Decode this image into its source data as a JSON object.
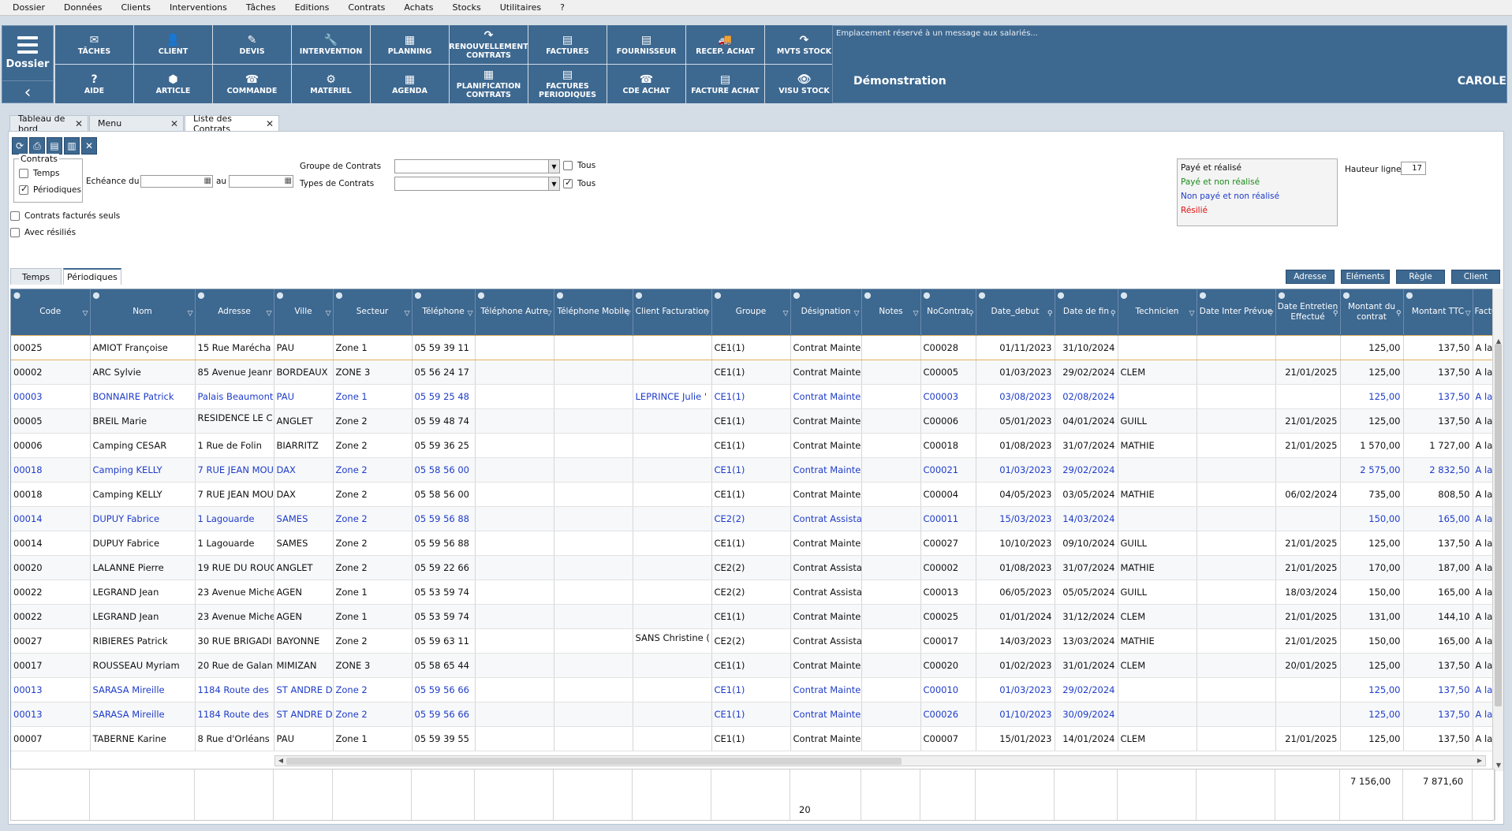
{
  "menu": [
    "Dossier",
    "Données",
    "Clients",
    "Interventions",
    "Tâches",
    "Editions",
    "Contrats",
    "Achats",
    "Stocks",
    "Utilitaires",
    "?"
  ],
  "dossier": {
    "label": "Dossier",
    "icon": "hamburger-icon",
    "back_icon": "chevron-left-icon"
  },
  "toolbar_buttons": [
    {
      "label": "TÂCHES",
      "icon": "✉"
    },
    {
      "label": "CLIENT",
      "icon": "👤"
    },
    {
      "label": "DEVIS",
      "icon": "✎"
    },
    {
      "label": "INTERVENTION",
      "icon": "🔧"
    },
    {
      "label": "PLANNING",
      "icon": "▦"
    },
    {
      "label": "RENOUVELLEMENT CONTRATS",
      "icon": "↷"
    },
    {
      "label": "FACTURES",
      "icon": "▤"
    },
    {
      "label": "FOURNISSEUR",
      "icon": "▤"
    },
    {
      "label": "RECEP. ACHAT",
      "icon": "🚚"
    },
    {
      "label": "MVTS STOCK",
      "icon": "↷"
    },
    {
      "label": "AIDE",
      "icon": "?"
    },
    {
      "label": "ARTICLE",
      "icon": "⬢"
    },
    {
      "label": "COMMANDE",
      "icon": "☎"
    },
    {
      "label": "MATERIEL",
      "icon": "⚙"
    },
    {
      "label": "AGENDA",
      "icon": "▦"
    },
    {
      "label": "PLANIFICATION CONTRATS",
      "icon": "▦"
    },
    {
      "label": "FACTURES PERIODIQUES",
      "icon": "▤"
    },
    {
      "label": "CDE ACHAT",
      "icon": "☎"
    },
    {
      "label": "FACTURE ACHAT",
      "icon": "▤"
    },
    {
      "label": "VISU STOCK",
      "icon": "👁"
    }
  ],
  "message_panel": {
    "text": "Emplacement réservé à un  message aux salariés...",
    "company": "Démonstration",
    "user": "CAROLE"
  },
  "tabs": [
    {
      "label": "Tableau de bord",
      "active": false
    },
    {
      "label": "Menu",
      "active": false
    },
    {
      "label": "Liste des Contrats",
      "active": true
    }
  ],
  "filters": {
    "contrats_legend": "Contrats",
    "temps": {
      "label": "Temps",
      "checked": false
    },
    "periodiques": {
      "label": "Périodiques",
      "checked": true
    },
    "echeance_label": "Echéance du",
    "au_label": "au",
    "factures_seuls": {
      "label": "Contrats facturés seuls",
      "checked": false
    },
    "avec_resilies": {
      "label": "Avec résiliés",
      "checked": false
    },
    "groupe_label": "Groupe de Contrats",
    "types_label": "Types de Contrats",
    "tous1": {
      "label": "Tous",
      "checked": false
    },
    "tous2": {
      "label": "Tous",
      "checked": true
    }
  },
  "legend": [
    {
      "label": "Payé et réalisé",
      "color": "#111111"
    },
    {
      "label": "Payé et non réalisé",
      "color": "#1a8a1a"
    },
    {
      "label": "Non payé et non réalisé",
      "color": "#1e3cc8"
    },
    {
      "label": "Résilié",
      "color": "#e01010"
    }
  ],
  "hauteur_ligne": {
    "label": "Hauteur ligne",
    "value": "17"
  },
  "subtabs": [
    {
      "label": "Temps",
      "active": false
    },
    {
      "label": "Périodiques",
      "active": true
    }
  ],
  "right_buttons": [
    "Adresse",
    "Eléments",
    "Règle",
    "Client"
  ],
  "columns": [
    {
      "label": "Code",
      "w": 100
    },
    {
      "label": "Nom",
      "w": 133
    },
    {
      "label": "Adresse",
      "w": 100
    },
    {
      "label": "Ville",
      "w": 75
    },
    {
      "label": "Secteur",
      "w": 100
    },
    {
      "label": "Téléphone",
      "w": 80
    },
    {
      "label": "Téléphone Autre",
      "w": 100
    },
    {
      "label": "Téléphone Mobile",
      "w": 100
    },
    {
      "label": "Client Facturation",
      "w": 100
    },
    {
      "label": "Groupe",
      "w": 100
    },
    {
      "label": "Désignation",
      "w": 90
    },
    {
      "label": "Notes",
      "w": 75
    },
    {
      "label": "NoContrat",
      "w": 70
    },
    {
      "label": "Date_debut",
      "w": 100
    },
    {
      "label": "Date de fin",
      "w": 80
    },
    {
      "label": "Technicien",
      "w": 100
    },
    {
      "label": "Date Inter Prévue",
      "w": 100
    },
    {
      "label": "Date Entretien Effectué",
      "w": 82
    },
    {
      "label": "Montant du contrat",
      "w": 80
    },
    {
      "label": "Montant TTC",
      "w": 88
    },
    {
      "label": "Factu",
      "w": 29
    }
  ],
  "rows": [
    {
      "blue": false,
      "cells": [
        "00025",
        "AMIOT Françoise",
        "15 Rue Marécha",
        "PAU",
        "Zone 1",
        "05 59 39 11",
        "",
        "",
        "",
        "CE1(1)",
        "Contrat Mainte",
        "",
        "C00028",
        "01/11/2023",
        "31/10/2024",
        "",
        "",
        "",
        "125,00",
        "137,50",
        "A la s"
      ]
    },
    {
      "blue": false,
      "cells": [
        "00002",
        "ARC Sylvie",
        "85 Avenue Jeanr",
        "BORDEAUX",
        "ZONE 3",
        "05 56 24 17",
        "",
        "",
        "",
        "CE1(1)",
        "Contrat Mainte",
        "",
        "C00005",
        "01/03/2023",
        "29/02/2024",
        "CLEM",
        "",
        "21/01/2025",
        "125,00",
        "137,50",
        "A la s"
      ]
    },
    {
      "blue": true,
      "cells": [
        "00003",
        "BONNAIRE Patrick",
        "Palais Beaumont",
        "PAU",
        "Zone 1",
        "05 59 25 48",
        "",
        "",
        "LEPRINCE Julie '",
        "CE1(1)",
        "Contrat Mainte",
        "",
        "C00003",
        "03/08/2023",
        "02/08/2024",
        "",
        "",
        "",
        "125,00",
        "137,50",
        "A la s"
      ]
    },
    {
      "blue": false,
      "top_addr": true,
      "cells": [
        "00005",
        "BREIL Marie",
        "RESIDENCE LE C",
        "ANGLET",
        "Zone 2",
        "05 59 48 74",
        "",
        "",
        "",
        "CE1(1)",
        "Contrat Mainte",
        "",
        "C00006",
        "05/01/2023",
        "04/01/2024",
        "GUILL",
        "",
        "21/01/2025",
        "125,00",
        "137,50",
        "A la s"
      ]
    },
    {
      "blue": false,
      "cells": [
        "00006",
        "Camping CESAR",
        "1 Rue de Folin",
        "BIARRITZ",
        "Zone 2",
        "05 59 36 25",
        "",
        "",
        "",
        "CE1(1)",
        "Contrat Mainte",
        "",
        "C00018",
        "01/08/2023",
        "31/07/2024",
        "MATHIE",
        "",
        "21/01/2025",
        "1 570,00",
        "1 727,00",
        "A la s"
      ]
    },
    {
      "blue": true,
      "cells": [
        "00018",
        "Camping KELLY",
        "7 RUE JEAN MOU",
        "DAX",
        "Zone 2",
        "05 58 56 00",
        "",
        "",
        "",
        "CE1(1)",
        "Contrat Mainte",
        "",
        "C00021",
        "01/03/2023",
        "29/02/2024",
        "",
        "",
        "",
        "2 575,00",
        "2 832,50",
        "A la s"
      ]
    },
    {
      "blue": false,
      "cells": [
        "00018",
        "Camping KELLY",
        "7 RUE JEAN MOU",
        "DAX",
        "Zone 2",
        "05 58 56 00",
        "",
        "",
        "",
        "CE1(1)",
        "Contrat Mainte",
        "",
        "C00004",
        "04/05/2023",
        "03/05/2024",
        "MATHIE",
        "",
        "06/02/2024",
        "735,00",
        "808,50",
        "A la s"
      ]
    },
    {
      "blue": true,
      "cells": [
        "00014",
        "DUPUY Fabrice",
        "1 Lagouarde",
        "SAMES",
        "Zone 2",
        "05 59 56 88",
        "",
        "",
        "",
        "CE2(2)",
        "Contrat Assista",
        "",
        "C00011",
        "15/03/2023",
        "14/03/2024",
        "",
        "",
        "",
        "150,00",
        "165,00",
        "A la s"
      ]
    },
    {
      "blue": false,
      "cells": [
        "00014",
        "DUPUY Fabrice",
        "1 Lagouarde",
        "SAMES",
        "Zone 2",
        "05 59 56 88",
        "",
        "",
        "",
        "CE1(1)",
        "Contrat Mainte",
        "",
        "C00027",
        "10/10/2023",
        "09/10/2024",
        "GUILL",
        "",
        "21/01/2025",
        "125,00",
        "137,50",
        "A la s"
      ]
    },
    {
      "blue": false,
      "cells": [
        "00020",
        "LALANNE Pierre",
        "19 RUE DU ROUC",
        "ANGLET",
        "Zone 2",
        "05 59 22 66",
        "",
        "",
        "",
        "CE2(2)",
        "Contrat Assista",
        "",
        "C00002",
        "01/08/2023",
        "31/07/2024",
        "MATHIE",
        "",
        "21/01/2025",
        "170,00",
        "187,00",
        "A la s"
      ]
    },
    {
      "blue": false,
      "cells": [
        "00022",
        "LEGRAND Jean",
        "23 Avenue Miche",
        "AGEN",
        "Zone 1",
        "05 53 59 74",
        "",
        "",
        "",
        "CE2(2)",
        "Contrat Assista",
        "",
        "C00013",
        "06/05/2023",
        "05/05/2024",
        "GUILL",
        "",
        "18/03/2024",
        "150,00",
        "165,00",
        "A la s"
      ]
    },
    {
      "blue": false,
      "cells": [
        "00022",
        "LEGRAND Jean",
        "23 Avenue Miche",
        "AGEN",
        "Zone 1",
        "05 53 59 74",
        "",
        "",
        "",
        "CE1(1)",
        "Contrat Mainte",
        "",
        "C00025",
        "01/01/2024",
        "31/12/2024",
        "CLEM",
        "",
        "21/01/2025",
        "131,00",
        "144,10",
        "A la s"
      ]
    },
    {
      "blue": false,
      "top_fact": true,
      "cells": [
        "00027",
        "RIBIERES Patrick",
        "30 RUE BRIGADI",
        "BAYONNE",
        "Zone 2",
        "05 59 63 11",
        "",
        "",
        "SANS Christine (",
        "CE2(2)",
        "Contrat Assista",
        "",
        "C00017",
        "14/03/2023",
        "13/03/2024",
        "MATHIE",
        "",
        "21/01/2025",
        "150,00",
        "165,00",
        "A la s"
      ]
    },
    {
      "blue": false,
      "cells": [
        "00017",
        "ROUSSEAU Myriam",
        "20 Rue de Galan",
        "MIMIZAN",
        "ZONE 3",
        "05 58 65 44",
        "",
        "",
        "",
        "CE1(1)",
        "Contrat Mainte",
        "",
        "C00020",
        "01/02/2023",
        "31/01/2024",
        "CLEM",
        "",
        "20/01/2025",
        "125,00",
        "137,50",
        "A la s"
      ]
    },
    {
      "blue": true,
      "cells": [
        "00013",
        "SARASA Mireille",
        "1184 Route des",
        "ST ANDRE D",
        "Zone 2",
        "05 59 56 66",
        "",
        "",
        "",
        "CE1(1)",
        "Contrat Mainte",
        "",
        "C00010",
        "01/03/2023",
        "29/02/2024",
        "",
        "",
        "",
        "125,00",
        "137,50",
        "A la s"
      ]
    },
    {
      "blue": true,
      "cells": [
        "00013",
        "SARASA Mireille",
        "1184 Route des",
        "ST ANDRE D",
        "Zone 2",
        "05 59 56 66",
        "",
        "",
        "",
        "CE1(1)",
        "Contrat Mainte",
        "",
        "C00026",
        "01/10/2023",
        "30/09/2024",
        "",
        "",
        "",
        "125,00",
        "137,50",
        "A la s"
      ]
    },
    {
      "blue": false,
      "cells": [
        "00007",
        "TABERNE Karine",
        "8 Rue d'Orléans",
        "PAU",
        "Zone 1",
        "05 59 39 55",
        "",
        "",
        "",
        "CE1(1)",
        "Contrat Mainte",
        "",
        "C00007",
        "15/01/2023",
        "14/01/2024",
        "CLEM",
        "",
        "21/01/2025",
        "125,00",
        "137,50",
        "A la s"
      ]
    }
  ],
  "footer": {
    "count": "20",
    "total_ht": "7 156,00",
    "total_ttc": "7 871,60"
  }
}
